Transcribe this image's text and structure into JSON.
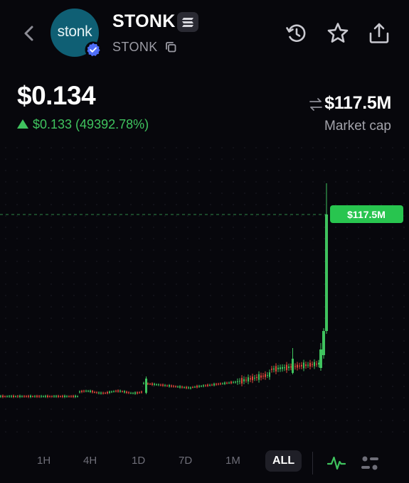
{
  "header": {
    "token_name": "STONK",
    "ticker": "STONK",
    "logo_text": "stonk",
    "icons": [
      "back-chevron-icon",
      "verified-badge-icon",
      "solana-chain-icon",
      "copy-icon",
      "history-icon",
      "star-icon",
      "share-icon"
    ]
  },
  "price": {
    "value": "$0.134",
    "change": "$0.133 (49392.78%)",
    "direction": "up"
  },
  "market_cap": {
    "value": "$117.5M",
    "label": "Market cap"
  },
  "chart_data": {
    "type": "candlestick",
    "unit": "market cap",
    "current_label": "$117.5M",
    "colors": {
      "up": "#3fc35e",
      "down": "#e0493c",
      "background": "#07070c"
    }
  },
  "timeframes": {
    "options": [
      "1H",
      "4H",
      "1D",
      "7D",
      "1M",
      "ALL"
    ],
    "selected": "ALL"
  },
  "colors": {
    "positive": "#3fc35e",
    "badge": "#4f6ef7",
    "logo_bg": "#0f5f74"
  }
}
